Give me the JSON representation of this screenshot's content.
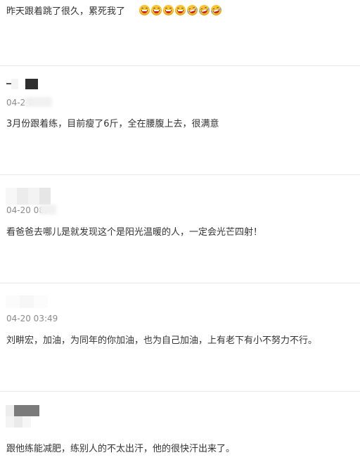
{
  "comments": [
    {
      "text": "昨天跟着跳了很久，累死我了",
      "emojis": [
        "laughing-emoji-icon",
        "laughing-emoji-icon",
        "laughing-emoji-icon",
        "laughing-emoji-icon",
        "rofl-emoji-icon",
        "rofl-emoji-icon",
        "rofl-emoji-icon"
      ]
    },
    {
      "date": "04-2   7",
      "text": "3月份跟着练，目前瘦了6斤，全在腰腹上去，很满意"
    },
    {
      "date": "04-20 08:",
      "text": "看爸爸去哪儿是就发现这个是阳光温暖的人，一定会光芒四射！"
    },
    {
      "date": "04-20 03:49",
      "text": "刘畊宏，加油，为同年的你加油，也为自己加油，上有老下有小不努力不行。"
    },
    {
      "text": "跟他练能减肥，练别人的不太出汗，他的很快汗出来了。"
    }
  ]
}
